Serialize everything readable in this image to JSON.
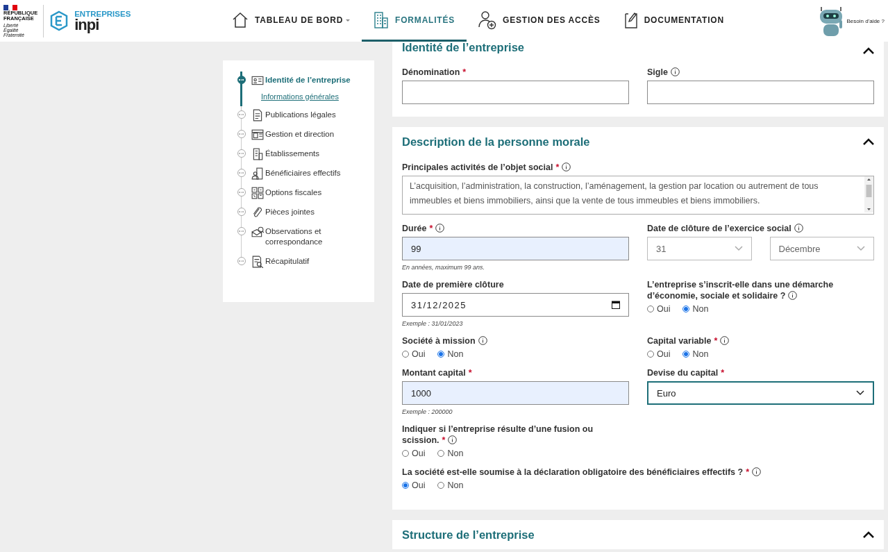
{
  "header": {
    "brand": {
      "state_lines": [
        "RÉPUBLIQUE",
        "FRANÇAISE"
      ],
      "motto": [
        "Liberté",
        "Égalité",
        "Fraternité"
      ],
      "product_top": "ENTREPRISES",
      "product_name": "inpi"
    },
    "nav": [
      {
        "label": "TABLEAU DE BORD",
        "selected": false,
        "dropdown": true
      },
      {
        "label": "FORMALITÉS",
        "selected": true,
        "dropdown": false
      },
      {
        "label": "GESTION DES ACCÈS",
        "selected": false,
        "dropdown": false
      },
      {
        "label": "DOCUMENTATION",
        "selected": false,
        "dropdown": false
      }
    ],
    "help": "Besoin d'aide ?"
  },
  "steps": [
    {
      "label": "Identité de l’entreprise",
      "selected": true,
      "children": [
        {
          "label": "Informations générales",
          "selected": true
        }
      ]
    },
    {
      "label": "Publications légales",
      "selected": false
    },
    {
      "label": "Gestion et direction",
      "selected": false
    },
    {
      "label": "Établissements",
      "selected": false
    },
    {
      "label": "Bénéficiaires effectifs",
      "selected": false
    },
    {
      "label": "Options fiscales",
      "selected": false
    },
    {
      "label": "Pièces jointes",
      "selected": false
    },
    {
      "label": "Observations et correspondance",
      "selected": false
    },
    {
      "label": "Récapitulatif",
      "selected": false
    }
  ],
  "sections": [
    {
      "title": "Identité de l’entreprise",
      "expanded": true,
      "fields": [
        {
          "kind": "text",
          "label": "Dénomination",
          "mark": "*",
          "highlighted": false
        },
        {
          "kind": "text",
          "label": "Sigle",
          "info": true,
          "highlighted": false
        }
      ]
    },
    {
      "title": "Description de la personne morale",
      "expanded": true,
      "fields": [
        {
          "kind": "textarea",
          "wide": true,
          "label": "Principales activités de l’objet social",
          "mark": "*",
          "info": true,
          "value": "L’acquisition, l’administration, la construction, l’aménagement, la gestion par location ou autrement de tous immeubles et biens immobiliers, ainsi que la vente de tous immeubles et biens immobiliers."
        },
        {
          "kind": "text",
          "label": "Durée",
          "mark": "*",
          "info": true,
          "value": "99",
          "highlighted": true,
          "hint": "En années, maximum 99 ans."
        },
        {
          "kind": "select_pair",
          "label": "Date de clôture de l’exercice social",
          "info": true,
          "values": [
            "31",
            "Décembre"
          ]
        },
        {
          "kind": "date",
          "label": "Date de première clôture",
          "value": "31/12/2025",
          "hint": "Exemple : 31/01/2023"
        },
        {
          "kind": "radio",
          "label": "L’entreprise s’inscrit-elle dans une démarche d’économie, sociale et solidaire ?",
          "info": true,
          "options": [
            {
              "label": "Oui",
              "selected": false
            },
            {
              "label": "Non",
              "selected": true
            }
          ]
        },
        {
          "kind": "radio",
          "label": "Société à mission",
          "info": true,
          "options": [
            {
              "label": "Oui",
              "selected": false
            },
            {
              "label": "Non",
              "selected": true
            }
          ]
        },
        {
          "kind": "radio",
          "label": "Capital variable",
          "mark": "*",
          "info": true,
          "options": [
            {
              "label": "Oui",
              "selected": false
            },
            {
              "label": "Non",
              "selected": true
            }
          ]
        },
        {
          "kind": "text",
          "label": "Montant capital",
          "mark": "*",
          "value": "1000",
          "highlighted": true,
          "hint": "Exemple : 200000"
        },
        {
          "kind": "select",
          "label": "Devise du capital",
          "mark": "*",
          "value": "Euro",
          "focused": true
        },
        {
          "kind": "radio",
          "label": "Indiquer si l’entreprise résulte d’une fusion ou scission.",
          "mark": "*",
          "info": true,
          "options": [
            {
              "label": "Oui",
              "selected": false
            },
            {
              "label": "Non",
              "selected": false
            }
          ]
        },
        {
          "kind": "spacer"
        },
        {
          "kind": "radio",
          "wide": true,
          "label": "La société est-elle soumise à la déclaration obligatoire des bénéficiaires effectifs ?",
          "mark": "*",
          "info": true,
          "options": [
            {
              "label": "Oui",
              "selected": true
            },
            {
              "label": "Non",
              "selected": false
            }
          ]
        }
      ]
    },
    {
      "title": "Structure de l’entreprise",
      "expanded": true
    }
  ]
}
